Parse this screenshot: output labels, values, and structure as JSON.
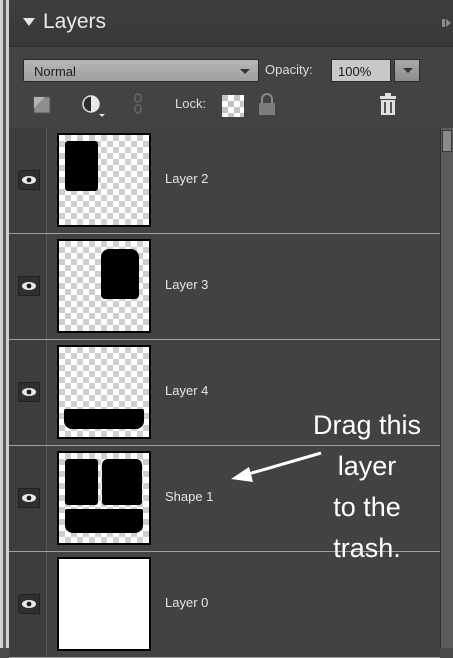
{
  "panel": {
    "title": "Layers",
    "blend_mode": "Normal",
    "opacity_label": "Opacity:",
    "opacity_value": "100%",
    "lock_label": "Lock:"
  },
  "layers": [
    {
      "name": "Layer 2",
      "thumbnail": "transparent-with-top-left-rectangle"
    },
    {
      "name": "Layer 3",
      "thumbnail": "transparent-with-right-rectangle"
    },
    {
      "name": "Layer 4",
      "thumbnail": "transparent-with-bottom-bar"
    },
    {
      "name": "Shape 1",
      "thumbnail": "three-rounded-blocks"
    },
    {
      "name": "Layer 0",
      "thumbnail": "white-fill"
    }
  ],
  "annotation": {
    "text_lines": [
      "Drag this",
      "layer",
      "to the",
      "trash."
    ]
  },
  "icons": {
    "collapse": "triangle-down-icon",
    "panel_menu": "panel-menu-icon",
    "new_layer": "new-layer-icon",
    "adjustment": "adjustment-layer-icon",
    "link": "link-icon",
    "lock_transparent": "lock-transparent-pixels-icon",
    "lock_all": "lock-icon",
    "delete": "trash-icon",
    "visibility": "eye-icon"
  },
  "colors": {
    "panel_bg": "#434343",
    "header_bg": "#3a3a3a",
    "text": "#e6e6e6",
    "row_divider": "#a0a0a0"
  }
}
